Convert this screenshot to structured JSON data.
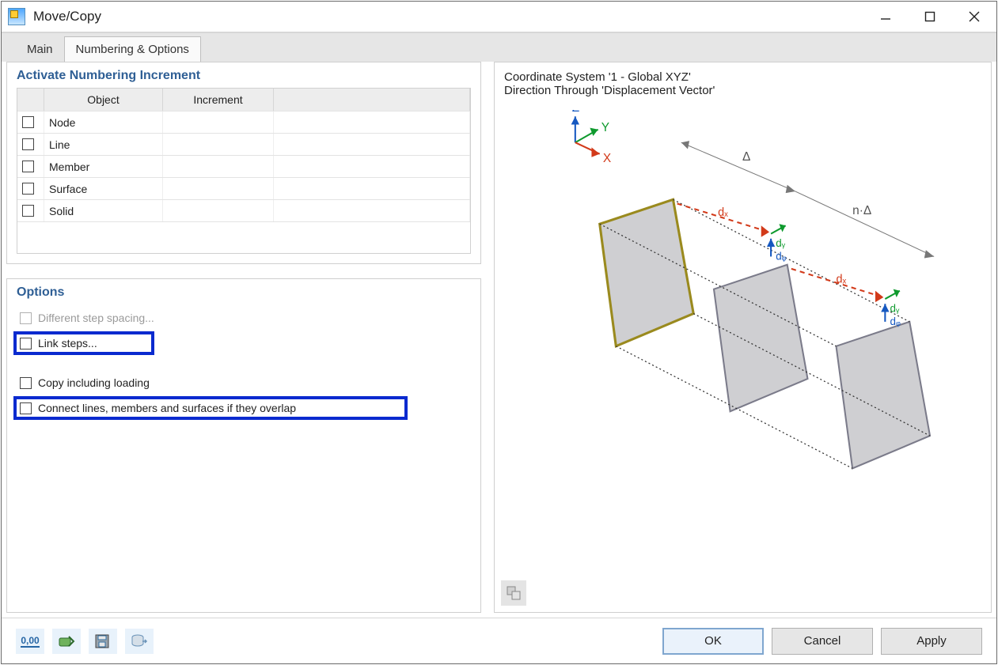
{
  "window": {
    "title": "Move/Copy"
  },
  "tabs": {
    "main": "Main",
    "numbering": "Numbering & Options"
  },
  "numbering_section": {
    "title": "Activate Numbering Increment",
    "headers": {
      "object": "Object",
      "increment": "Increment"
    },
    "rows": [
      "Node",
      "Line",
      "Member",
      "Surface",
      "Solid"
    ]
  },
  "options_section": {
    "title": "Options",
    "different_step": "Different step spacing...",
    "link_steps": "Link steps...",
    "copy_loading": "Copy including loading",
    "connect_overlap": "Connect lines, members and surfaces if they overlap"
  },
  "preview": {
    "line1": "Coordinate System '1 - Global XYZ'",
    "line2": "Direction Through 'Displacement Vector'",
    "axes": {
      "x": "X",
      "y": "Y",
      "z": "Z"
    },
    "labels": {
      "delta": "Δ",
      "ndelta": "n·Δ",
      "dx": "dₓ",
      "dy": "dᵧ",
      "dz": "dᵩ"
    }
  },
  "buttons": {
    "units": "0,00",
    "ok": "OK",
    "cancel": "Cancel",
    "apply": "Apply"
  }
}
